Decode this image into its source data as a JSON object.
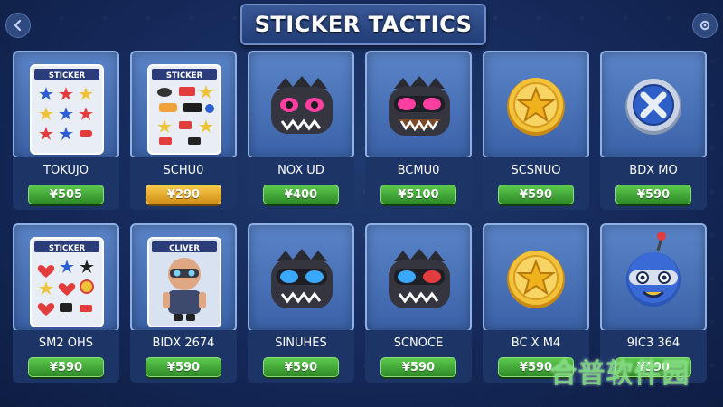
{
  "header": {
    "title": "STICKER TACTICS"
  },
  "items": [
    {
      "name": "TOKUJO",
      "price": "¥505",
      "art": "sticker-sheet-stars-icon",
      "button": "green"
    },
    {
      "name": "SCHU0",
      "price": "¥290",
      "art": "sticker-sheet-mixed-icon",
      "button": "gold"
    },
    {
      "name": "NOX UD",
      "price": "¥400",
      "art": "monster-head-pink-eyes-icon",
      "button": "green"
    },
    {
      "name": "BCMU0",
      "price": "¥5100",
      "art": "monster-head-pink-goggles-icon",
      "button": "green"
    },
    {
      "name": "SCSNUO",
      "price": "¥590",
      "art": "gold-star-coin-icon",
      "button": "green"
    },
    {
      "name": "BDX MO",
      "price": "¥590",
      "art": "blue-silver-emblem-icon",
      "button": "green"
    },
    {
      "name": "SM2 OHS",
      "price": "¥590",
      "art": "sticker-sheet-hearts-icon",
      "button": "green"
    },
    {
      "name": "BIDX 2674",
      "price": "¥590",
      "art": "character-pack-icon",
      "button": "green"
    },
    {
      "name": "SINUHES",
      "price": "¥590",
      "art": "monster-head-blue-goggles-icon",
      "button": "green"
    },
    {
      "name": "SCNOCE",
      "price": "¥590",
      "art": "monster-head-red-blue-goggles-icon",
      "button": "green"
    },
    {
      "name": "BC X M4",
      "price": "¥590",
      "art": "gold-star-coin-icon",
      "button": "green"
    },
    {
      "name": "9IC3 364",
      "price": "¥590",
      "art": "blue-robot-head-icon",
      "button": "green"
    }
  ],
  "sticker_sheet_labels": {
    "sheet1": "STICKER",
    "sheet2": "STICKER",
    "sheet3": "STICKER",
    "sheet4": "CLIVER"
  },
  "watermark": "合普软件园",
  "colors": {
    "background": "#15295a",
    "card": "#4a74bc",
    "price_green": "#3fa836",
    "price_gold": "#e4a42a"
  }
}
